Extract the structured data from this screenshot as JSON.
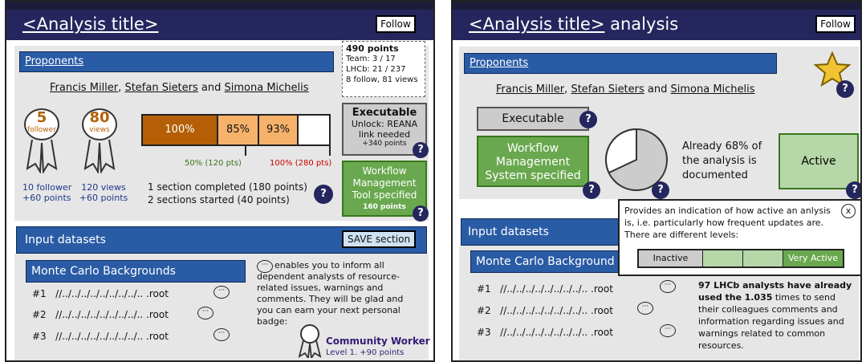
{
  "left": {
    "title_main": "<Analysis title>",
    "follow": "Follow",
    "proponents": "Proponents",
    "names": {
      "n1": "Francis Miller",
      "sep1": ",",
      "n2": "Stefan Sieters",
      "sep2": " and ",
      "n3": "Simona Michelis"
    },
    "points_box": {
      "points": "490 points",
      "team": "Team: 3 / 17",
      "lhcb": "LHCb: 21 / 237",
      "follow": "8 follow, 81 views"
    },
    "badge_followers": {
      "value": "5",
      "label": "follower"
    },
    "badge_views": {
      "value": "80",
      "label": "views"
    },
    "stats": {
      "followers": "10 follower",
      "followers_pts": "+60 points",
      "views": "120 views",
      "views_pts": "+60 points"
    },
    "progress": {
      "seg1": "100%",
      "seg2": "85%",
      "seg3": "93%",
      "mark1": "50% (120 pts)",
      "mark2": "100% (280 pts)",
      "fill_fraction": 0.85
    },
    "sections": {
      "completed": "1 section completed (180 points)",
      "started": "2 sections started (40 points)"
    },
    "executable": {
      "title": "Executable",
      "text": "Unlock: REANA link needed",
      "pts": "+340 points"
    },
    "workflow": {
      "title": "Workflow Management Tool specified",
      "pts": "160 points"
    },
    "input": {
      "title": "Input datasets",
      "save": "SAVE section"
    },
    "mc": {
      "title": "Monte Carlo Backgrounds",
      "rows": [
        {
          "num": "#1",
          "path": "//../../../../../../../../.. .root"
        },
        {
          "num": "#2",
          "path": "//../../../../../../../../.. .root"
        },
        {
          "num": "#3",
          "path": "//../../../../../../../../.. .root"
        }
      ]
    },
    "comments": {
      "text": "enables you to inform all dependent analysts of resource-related issues, warnings and comments. They will be glad and you can earn your next personal badge:",
      "badge": "Community Worker",
      "badge_pts": "Level 1. +90 points"
    },
    "help_icon": "?"
  },
  "right": {
    "title_main": "<Analysis title>",
    "title_suffix": " analysis",
    "follow": "Follow",
    "proponents": "Proponents",
    "names": {
      "n1": "Francis Miller",
      "sep1": ",",
      "n2": "Stefan Sieters",
      "sep2": " and ",
      "n3": "Simona Michelis"
    },
    "executable": "Executable",
    "workflow": "Workflow Management System specified",
    "pie_text": "Already 68% of the analysis is documented",
    "pie_fraction": 0.68,
    "active": "Active",
    "input": "Input datasets",
    "mc": {
      "title": "Monte Carlo Background",
      "rows": [
        {
          "num": "#1",
          "path": "//../../../../../../../../.. .root"
        },
        {
          "num": "#2",
          "path": "//../../../../../../../../.. .root"
        },
        {
          "num": "#3",
          "path": "//../../../../../../../../.. .root"
        }
      ]
    },
    "tooltip": {
      "text": "Provides an indication of how active an anlysis is, i.e. particularly how frequent updates are. There are different levels:",
      "close": "x",
      "levels": [
        "Inactive",
        "",
        "",
        "Very Active"
      ]
    },
    "lhcb_text_pre": "97 LHCb analysts have already used the",
    "lhcb_count": "1.035",
    "lhcb_text_post": "times to send their colleagues comments and information regarding issues and warnings related to common resources."
  }
}
